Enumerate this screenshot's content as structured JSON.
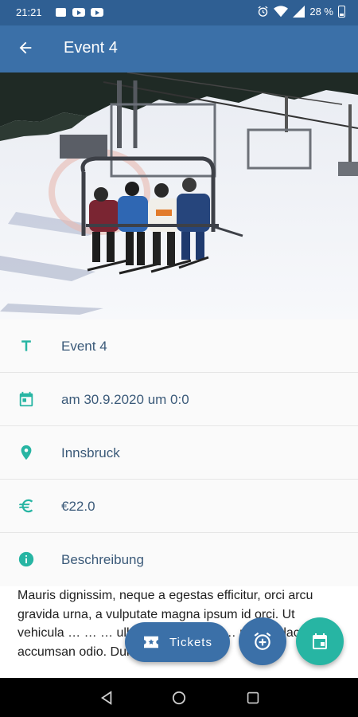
{
  "status_bar": {
    "time": "21:21",
    "battery": "28 %"
  },
  "app_bar": {
    "title": "Event 4"
  },
  "details": {
    "name": "Event 4",
    "datetime": "am 30.9.2020 um 0:0",
    "location": "Innsbruck",
    "price": "€22.0",
    "description_heading": "Beschreibung",
    "description": "Mauris dignissim, neque a egestas efficitur, orci arcu gravida urna, a vulputate magna ipsum id orci. Ut vehicula … … … ullamcorper, ma… … ultrices lacus sem accumsan odio. Duis faucibus"
  },
  "actions": {
    "tickets_label": "Tickets"
  },
  "colors": {
    "primary": "#3b70a8",
    "status_bar": "#2f5f93",
    "accent": "#27b5a3",
    "label_text": "#3b5a79"
  },
  "icons": [
    "arrow-back-icon",
    "title-icon",
    "calendar-icon",
    "location-pin-icon",
    "euro-icon",
    "info-icon",
    "ticket-icon",
    "alarm-add-icon",
    "event-icon"
  ]
}
